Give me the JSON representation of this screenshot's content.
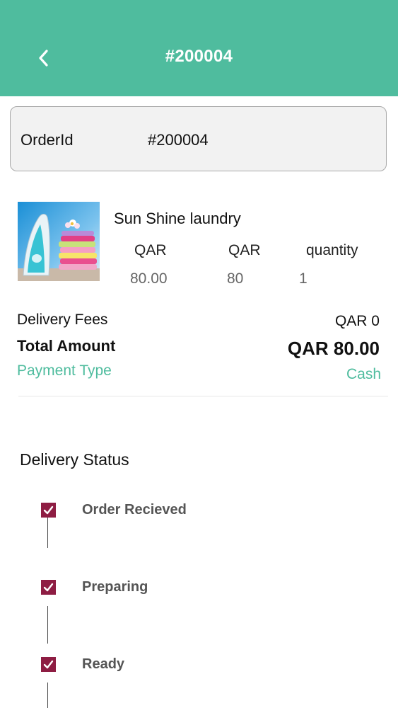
{
  "header": {
    "title": "#200004",
    "back_icon": "chevron-left-icon",
    "background": "#4fbc9e"
  },
  "order": {
    "label": "OrderId",
    "value": "#200004"
  },
  "item": {
    "image": "laundry-iron-clothes-image",
    "shop_name": "Sun Shine laundry",
    "columns": [
      {
        "header": "QAR",
        "value": "80.00"
      },
      {
        "header": "QAR",
        "value": "80"
      },
      {
        "header": "quantity",
        "value": "1"
      }
    ]
  },
  "summary": {
    "delivery_fees_label": "Delivery Fees",
    "delivery_fees_value": "QAR 0",
    "total_label": "Total Amount",
    "total_value": "QAR 80.00",
    "payment_label": "Payment Type",
    "payment_value": "Cash",
    "accent": "#4fbc9e"
  },
  "delivery_status": {
    "title": "Delivery Status",
    "check_color": "#8e1d43",
    "steps": [
      {
        "label": "Order Recieved",
        "checked": true
      },
      {
        "label": "Preparing",
        "checked": true
      },
      {
        "label": "Ready",
        "checked": true
      }
    ]
  }
}
